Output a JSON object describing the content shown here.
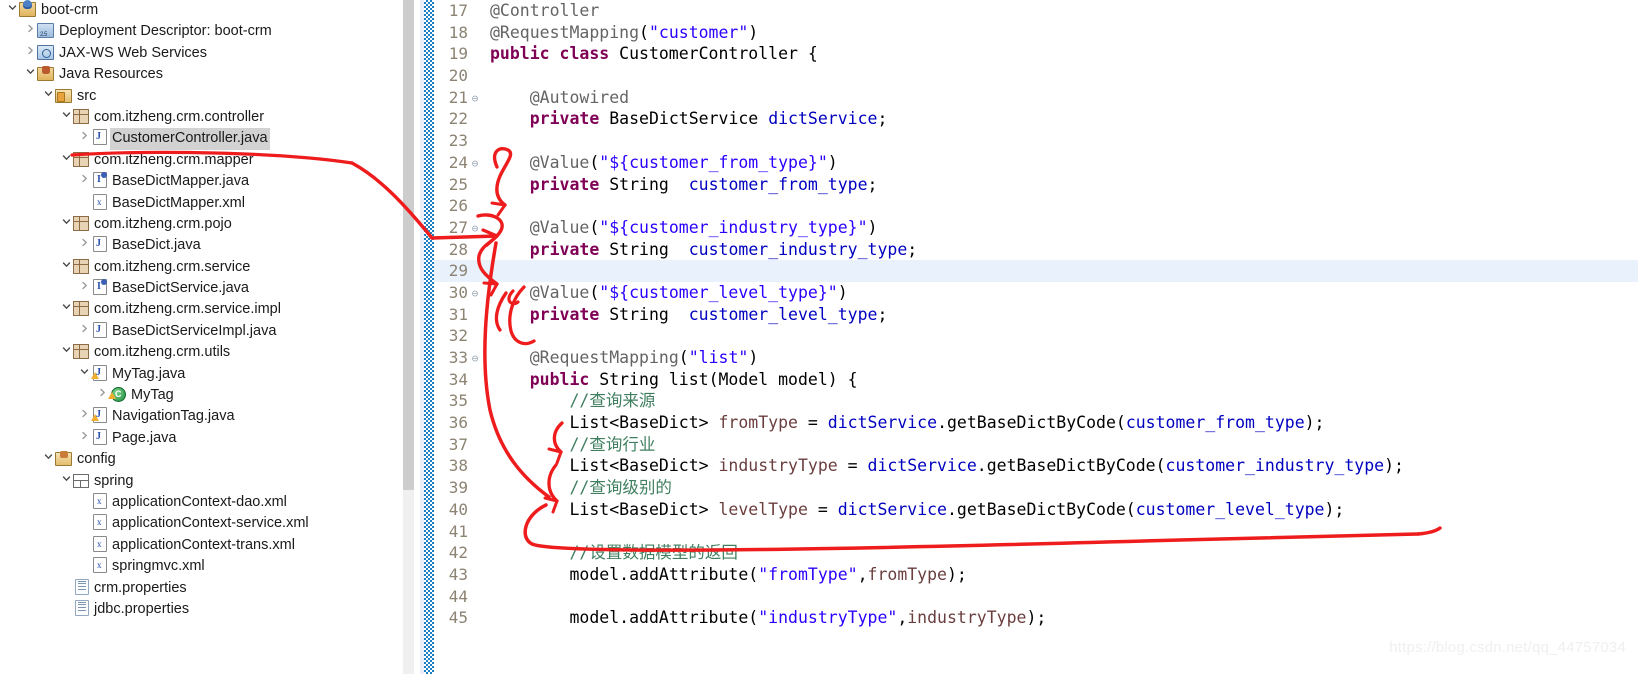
{
  "explorer": {
    "name": "package-explorer",
    "items": [
      {
        "label": "boot-crm",
        "indent": 0,
        "twisty": "down",
        "icon": "project-icon",
        "selected": false
      },
      {
        "label": "Deployment Descriptor: boot-crm",
        "indent": 1,
        "twisty": "right",
        "icon": "deployment-descriptor-icon",
        "selected": false
      },
      {
        "label": "JAX-WS Web Services",
        "indent": 1,
        "twisty": "right",
        "icon": "jaxws-icon",
        "selected": false
      },
      {
        "label": "Java Resources",
        "indent": 1,
        "twisty": "down",
        "icon": "java-resources-icon",
        "selected": false
      },
      {
        "label": "src",
        "indent": 2,
        "twisty": "down",
        "icon": "source-folder-icon",
        "selected": false
      },
      {
        "label": "com.itzheng.crm.controller",
        "indent": 3,
        "twisty": "down",
        "icon": "package-icon",
        "selected": false
      },
      {
        "label": "CustomerController.java",
        "indent": 4,
        "twisty": "right",
        "icon": "java-file-icon",
        "selected": true
      },
      {
        "label": "com.itzheng.crm.mapper",
        "indent": 3,
        "twisty": "down",
        "icon": "package-icon",
        "selected": false
      },
      {
        "label": "BaseDictMapper.java",
        "indent": 4,
        "twisty": "right",
        "icon": "java-interface-icon",
        "selected": false
      },
      {
        "label": "BaseDictMapper.xml",
        "indent": 4,
        "twisty": "none",
        "icon": "xml-file-icon",
        "selected": false
      },
      {
        "label": "com.itzheng.crm.pojo",
        "indent": 3,
        "twisty": "down",
        "icon": "package-icon",
        "selected": false
      },
      {
        "label": "BaseDict.java",
        "indent": 4,
        "twisty": "right",
        "icon": "java-file-icon",
        "selected": false
      },
      {
        "label": "com.itzheng.crm.service",
        "indent": 3,
        "twisty": "down",
        "icon": "package-icon",
        "selected": false
      },
      {
        "label": "BaseDictService.java",
        "indent": 4,
        "twisty": "right",
        "icon": "java-interface-icon",
        "selected": false
      },
      {
        "label": "com.itzheng.crm.service.impl",
        "indent": 3,
        "twisty": "down",
        "icon": "package-icon",
        "selected": false
      },
      {
        "label": "BaseDictServiceImpl.java",
        "indent": 4,
        "twisty": "right",
        "icon": "java-file-icon",
        "selected": false
      },
      {
        "label": "com.itzheng.crm.utils",
        "indent": 3,
        "twisty": "down",
        "icon": "package-icon",
        "selected": false
      },
      {
        "label": "MyTag.java",
        "indent": 4,
        "twisty": "down",
        "icon": "java-file-warning-icon",
        "selected": false
      },
      {
        "label": "MyTag",
        "indent": 5,
        "twisty": "right",
        "icon": "class-warning-icon",
        "selected": false
      },
      {
        "label": "NavigationTag.java",
        "indent": 4,
        "twisty": "right",
        "icon": "java-file-warning-icon",
        "selected": false
      },
      {
        "label": "Page.java",
        "indent": 4,
        "twisty": "right",
        "icon": "java-file-icon",
        "selected": false
      },
      {
        "label": "config",
        "indent": 2,
        "twisty": "down",
        "icon": "config-folder-icon",
        "selected": false
      },
      {
        "label": "spring",
        "indent": 3,
        "twisty": "down",
        "icon": "spring-folder-icon",
        "selected": false
      },
      {
        "label": "applicationContext-dao.xml",
        "indent": 4,
        "twisty": "none",
        "icon": "xml-file-icon",
        "selected": false
      },
      {
        "label": "applicationContext-service.xml",
        "indent": 4,
        "twisty": "none",
        "icon": "xml-file-icon",
        "selected": false
      },
      {
        "label": "applicationContext-trans.xml",
        "indent": 4,
        "twisty": "none",
        "icon": "xml-file-icon",
        "selected": false
      },
      {
        "label": "springmvc.xml",
        "indent": 4,
        "twisty": "none",
        "icon": "xml-file-icon",
        "selected": false
      },
      {
        "label": "crm.properties",
        "indent": 3,
        "twisty": "none",
        "icon": "properties-file-icon",
        "selected": false
      },
      {
        "label": "jdbc.properties",
        "indent": 3,
        "twisty": "none",
        "icon": "properties-file-icon",
        "selected": false
      }
    ]
  },
  "editor": {
    "name": "java-source-editor",
    "file": "CustomerController.java",
    "current_line": 29,
    "lines": [
      {
        "num": "17",
        "fold": "",
        "current": false,
        "tokens": [
          {
            "t": "@Controller",
            "c": "a"
          }
        ]
      },
      {
        "num": "18",
        "fold": "",
        "current": false,
        "tokens": [
          {
            "t": "@RequestMapping",
            "c": "a"
          },
          {
            "t": "(",
            "c": "t"
          },
          {
            "t": "\"customer\"",
            "c": "s"
          },
          {
            "t": ")",
            "c": "t"
          }
        ]
      },
      {
        "num": "19",
        "fold": "",
        "current": false,
        "tokens": [
          {
            "t": "public class ",
            "c": "k"
          },
          {
            "t": "CustomerController ",
            "c": "t"
          },
          {
            "t": "{",
            "c": "t"
          }
        ]
      },
      {
        "num": "20",
        "fold": "",
        "current": false,
        "tokens": [
          {
            "t": "",
            "c": "t"
          }
        ]
      },
      {
        "num": "21",
        "fold": "⊖",
        "current": false,
        "tokens": [
          {
            "t": "    ",
            "c": "t"
          },
          {
            "t": "@Autowired",
            "c": "a"
          }
        ]
      },
      {
        "num": "22",
        "fold": "",
        "current": false,
        "tokens": [
          {
            "t": "    ",
            "c": "t"
          },
          {
            "t": "private ",
            "c": "k"
          },
          {
            "t": "BaseDictService ",
            "c": "t"
          },
          {
            "t": "dictService",
            "c": "f"
          },
          {
            "t": ";",
            "c": "t"
          }
        ]
      },
      {
        "num": "23",
        "fold": "",
        "current": false,
        "tokens": [
          {
            "t": "",
            "c": "t"
          }
        ]
      },
      {
        "num": "24",
        "fold": "⊖",
        "current": false,
        "tokens": [
          {
            "t": "    ",
            "c": "t"
          },
          {
            "t": "@Value",
            "c": "a"
          },
          {
            "t": "(",
            "c": "t"
          },
          {
            "t": "\"${customer_from_type}\"",
            "c": "s"
          },
          {
            "t": ")",
            "c": "t"
          }
        ]
      },
      {
        "num": "25",
        "fold": "",
        "current": false,
        "tokens": [
          {
            "t": "    ",
            "c": "t"
          },
          {
            "t": "private ",
            "c": "k"
          },
          {
            "t": "String  ",
            "c": "t"
          },
          {
            "t": "customer_from_type",
            "c": "f"
          },
          {
            "t": ";",
            "c": "t"
          }
        ]
      },
      {
        "num": "26",
        "fold": "",
        "current": false,
        "tokens": [
          {
            "t": "",
            "c": "t"
          }
        ]
      },
      {
        "num": "27",
        "fold": "⊖",
        "current": false,
        "tokens": [
          {
            "t": "    ",
            "c": "t"
          },
          {
            "t": "@Value",
            "c": "a"
          },
          {
            "t": "(",
            "c": "t"
          },
          {
            "t": "\"${customer_industry_type}\"",
            "c": "s"
          },
          {
            "t": ")",
            "c": "t"
          }
        ]
      },
      {
        "num": "28",
        "fold": "",
        "current": false,
        "tokens": [
          {
            "t": "    ",
            "c": "t"
          },
          {
            "t": "private ",
            "c": "k"
          },
          {
            "t": "String  ",
            "c": "t"
          },
          {
            "t": "customer_industry_type",
            "c": "f"
          },
          {
            "t": ";",
            "c": "t"
          }
        ]
      },
      {
        "num": "29",
        "fold": "",
        "current": true,
        "tokens": [
          {
            "t": "",
            "c": "t"
          }
        ]
      },
      {
        "num": "30",
        "fold": "⊖",
        "current": false,
        "tokens": [
          {
            "t": "    ",
            "c": "t"
          },
          {
            "t": "@Value",
            "c": "a"
          },
          {
            "t": "(",
            "c": "t"
          },
          {
            "t": "\"${customer_level_type}\"",
            "c": "s"
          },
          {
            "t": ")",
            "c": "t"
          }
        ]
      },
      {
        "num": "31",
        "fold": "",
        "current": false,
        "tokens": [
          {
            "t": "    ",
            "c": "t"
          },
          {
            "t": "private ",
            "c": "k"
          },
          {
            "t": "String  ",
            "c": "t"
          },
          {
            "t": "customer_level_type",
            "c": "f"
          },
          {
            "t": ";",
            "c": "t"
          }
        ]
      },
      {
        "num": "32",
        "fold": "",
        "current": false,
        "tokens": [
          {
            "t": "",
            "c": "t"
          }
        ]
      },
      {
        "num": "33",
        "fold": "⊖",
        "current": false,
        "tokens": [
          {
            "t": "    ",
            "c": "t"
          },
          {
            "t": "@RequestMapping",
            "c": "a"
          },
          {
            "t": "(",
            "c": "t"
          },
          {
            "t": "\"list\"",
            "c": "s"
          },
          {
            "t": ")",
            "c": "t"
          }
        ]
      },
      {
        "num": "34",
        "fold": "",
        "current": false,
        "tokens": [
          {
            "t": "    ",
            "c": "t"
          },
          {
            "t": "public ",
            "c": "k"
          },
          {
            "t": "String list(Model model) {",
            "c": "t"
          }
        ]
      },
      {
        "num": "35",
        "fold": "",
        "current": false,
        "tokens": [
          {
            "t": "        ",
            "c": "t"
          },
          {
            "t": "//查询来源",
            "c": "c"
          }
        ]
      },
      {
        "num": "36",
        "fold": "",
        "current": false,
        "tokens": [
          {
            "t": "        ",
            "c": "t"
          },
          {
            "t": "List<BaseDict> ",
            "c": "t"
          },
          {
            "t": "fromType ",
            "c": "lv"
          },
          {
            "t": "= ",
            "c": "t"
          },
          {
            "t": "dictService",
            "c": "f"
          },
          {
            "t": ".getBaseDictByCode(",
            "c": "t"
          },
          {
            "t": "customer_from_type",
            "c": "f"
          },
          {
            "t": ");",
            "c": "t"
          }
        ]
      },
      {
        "num": "37",
        "fold": "",
        "current": false,
        "tokens": [
          {
            "t": "        ",
            "c": "t"
          },
          {
            "t": "//查询行业",
            "c": "c"
          }
        ]
      },
      {
        "num": "38",
        "fold": "",
        "current": false,
        "tokens": [
          {
            "t": "        ",
            "c": "t"
          },
          {
            "t": "List<BaseDict> ",
            "c": "t"
          },
          {
            "t": "industryType ",
            "c": "lv"
          },
          {
            "t": "= ",
            "c": "t"
          },
          {
            "t": "dictService",
            "c": "f"
          },
          {
            "t": ".getBaseDictByCode(",
            "c": "t"
          },
          {
            "t": "customer_industry_type",
            "c": "f"
          },
          {
            "t": ");",
            "c": "t"
          }
        ]
      },
      {
        "num": "39",
        "fold": "",
        "current": false,
        "tokens": [
          {
            "t": "        ",
            "c": "t"
          },
          {
            "t": "//查询级别的",
            "c": "c"
          }
        ]
      },
      {
        "num": "40",
        "fold": "",
        "current": false,
        "tokens": [
          {
            "t": "        ",
            "c": "t"
          },
          {
            "t": "List<BaseDict> ",
            "c": "t"
          },
          {
            "t": "levelType ",
            "c": "lv"
          },
          {
            "t": "= ",
            "c": "t"
          },
          {
            "t": "dictService",
            "c": "f"
          },
          {
            "t": ".getBaseDictByCode(",
            "c": "t"
          },
          {
            "t": "customer_level_type",
            "c": "f"
          },
          {
            "t": ");",
            "c": "t"
          }
        ]
      },
      {
        "num": "41",
        "fold": "",
        "current": false,
        "tokens": [
          {
            "t": "",
            "c": "t"
          }
        ]
      },
      {
        "num": "42",
        "fold": "",
        "current": false,
        "tokens": [
          {
            "t": "        ",
            "c": "t"
          },
          {
            "t": "//设置数据模型的返回",
            "c": "c"
          }
        ]
      },
      {
        "num": "43",
        "fold": "",
        "current": false,
        "tokens": [
          {
            "t": "        ",
            "c": "t"
          },
          {
            "t": "model.addAttribute(",
            "c": "t"
          },
          {
            "t": "\"fromType\"",
            "c": "s"
          },
          {
            "t": ",",
            "c": "t"
          },
          {
            "t": "fromType",
            "c": "lv"
          },
          {
            "t": ");",
            "c": "t"
          }
        ]
      },
      {
        "num": "44",
        "fold": "",
        "current": false,
        "tokens": [
          {
            "t": "",
            "c": "t"
          }
        ]
      },
      {
        "num": "45",
        "fold": "",
        "current": false,
        "tokens": [
          {
            "t": "        ",
            "c": "t"
          },
          {
            "t": "model.addAttribute(",
            "c": "t"
          },
          {
            "t": "\"industryType\"",
            "c": "s"
          },
          {
            "t": ",",
            "c": "t"
          },
          {
            "t": "industryType",
            "c": "lv"
          },
          {
            "t": ");",
            "c": "t"
          }
        ]
      }
    ]
  },
  "annotation": {
    "name": "red-ink-annotation",
    "color": "#ee1c1c"
  },
  "watermark": {
    "text": "https://blog.csdn.net/qq_44757034"
  }
}
